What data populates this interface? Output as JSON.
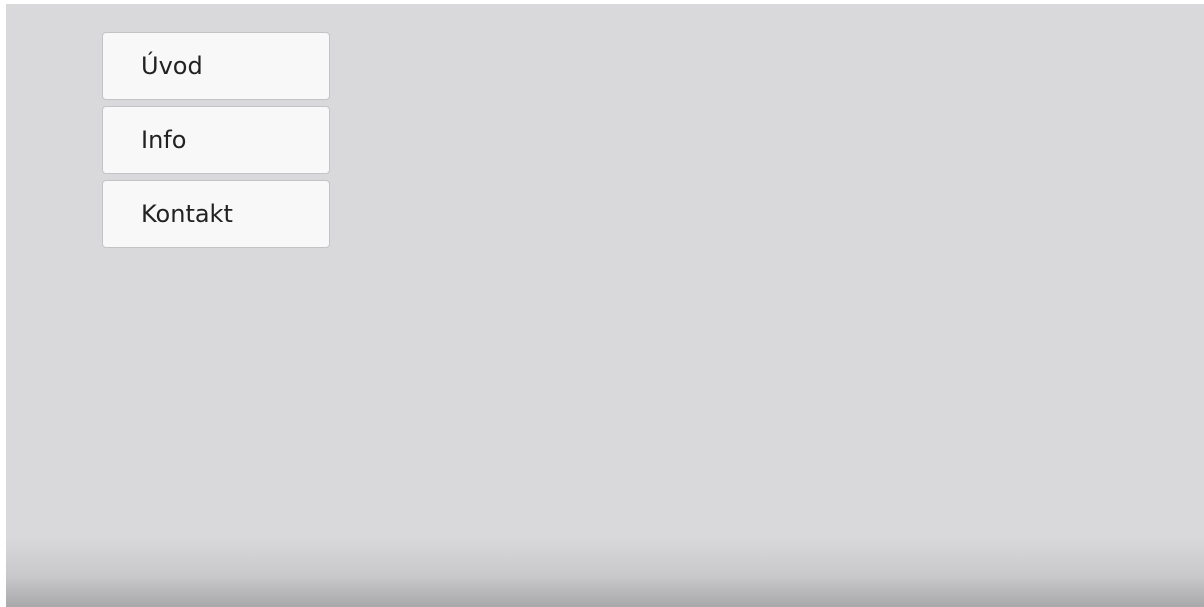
{
  "nav": {
    "items": [
      {
        "label": "Úvod"
      },
      {
        "label": "Info"
      },
      {
        "label": "Kontakt"
      }
    ]
  },
  "colors": {
    "background": "#d9d9db",
    "button_bg": "#f8f8f8",
    "button_border": "#c4c4c6",
    "text": "#222222"
  }
}
